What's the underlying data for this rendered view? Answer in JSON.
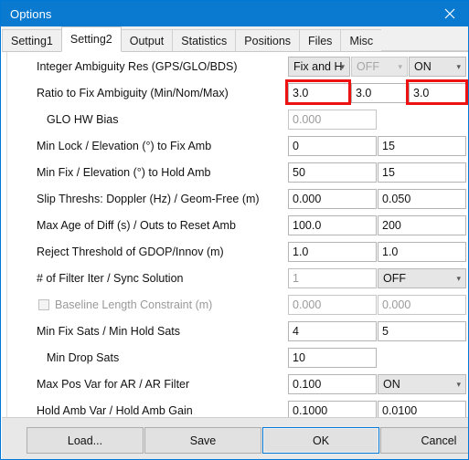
{
  "window": {
    "title": "Options",
    "close_icon": "close-icon"
  },
  "tabs": [
    {
      "label": "Setting1",
      "active": false
    },
    {
      "label": "Setting2",
      "active": true
    },
    {
      "label": "Output",
      "active": false
    },
    {
      "label": "Statistics",
      "active": false
    },
    {
      "label": "Positions",
      "active": false
    },
    {
      "label": "Files",
      "active": false
    },
    {
      "label": "Misc",
      "active": false
    }
  ],
  "form": {
    "rows": [
      {
        "label": "Integer Ambiguity Res (GPS/GLO/BDS)",
        "f1": "Fix and H",
        "f2": "OFF",
        "f3": "ON"
      },
      {
        "label": "Ratio to Fix Ambiguity (Min/Nom/Max)",
        "f1": "3.0",
        "f2": "3.0",
        "f3": "3.0"
      },
      {
        "label": "GLO HW Bias",
        "f1": "0.000"
      },
      {
        "label": "Min Lock / Elevation (°) to Fix Amb",
        "f1": "0",
        "f2": "15"
      },
      {
        "label": "Min Fix / Elevation (°) to Hold Amb",
        "f1": "50",
        "f2": "15"
      },
      {
        "label": "Slip Threshs: Doppler (Hz) / Geom-Free (m)",
        "f1": "0.000",
        "f2": "0.050"
      },
      {
        "label": "Max Age of Diff (s) / Outs to Reset Amb",
        "f1": "100.0",
        "f2": "200"
      },
      {
        "label": "Reject Threshold of GDOP/Innov (m)",
        "f1": "1.0",
        "f2": "1.0"
      },
      {
        "label": "# of Filter Iter / Sync Solution",
        "f1": "1",
        "f2": "OFF"
      },
      {
        "label": "Baseline Length Constraint (m)",
        "f1": "0.000",
        "f2": "0.000"
      },
      {
        "label": "Min Fix Sats / Min Hold Sats",
        "f1": "4",
        "f2": "5"
      },
      {
        "label": "Min Drop Sats",
        "f1": "10"
      },
      {
        "label": "Max Pos Var for AR  / AR Filter",
        "f1": "0.100",
        "f2": "ON"
      },
      {
        "label": "Hold Amb Var / Hold Amb Gain",
        "f1": "0.1000",
        "f2": "0.0100"
      }
    ]
  },
  "buttons": {
    "load": "Load...",
    "save": "Save",
    "ok": "OK",
    "cancel": "Cancel"
  },
  "colors": {
    "titlebar": "#0a7ad1",
    "annotation": "#ee1111",
    "focus": "#0078d7"
  }
}
